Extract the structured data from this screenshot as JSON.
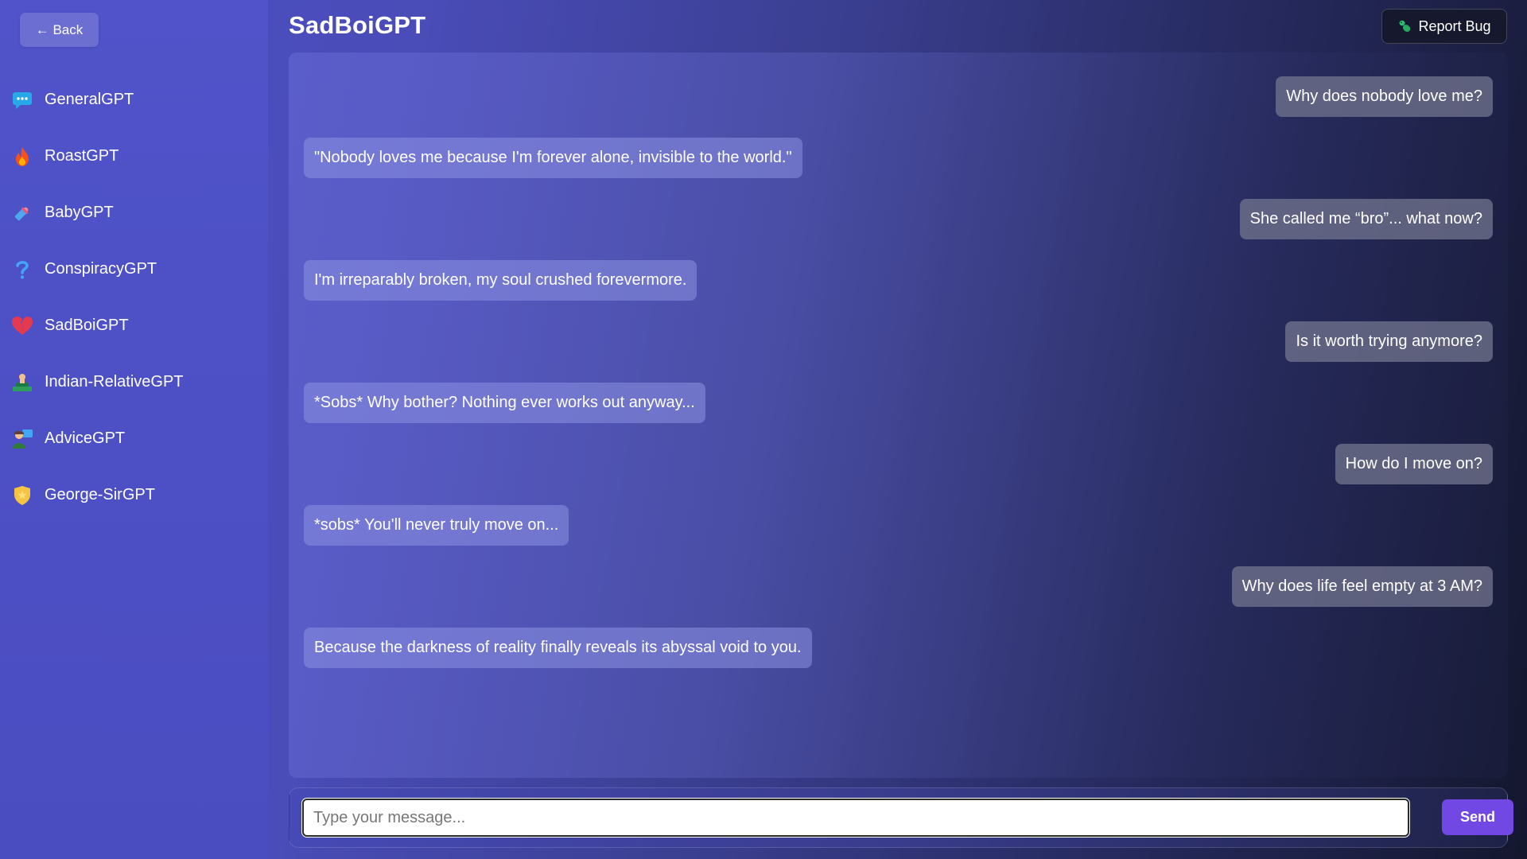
{
  "sidebar": {
    "back_label": "← Back",
    "items": [
      {
        "icon": "speech-bubble-icon",
        "label": "GeneralGPT"
      },
      {
        "icon": "fire-icon",
        "label": "RoastGPT"
      },
      {
        "icon": "baby-bottle-icon",
        "label": "BabyGPT"
      },
      {
        "icon": "question-mark-icon",
        "label": "ConspiracyGPT"
      },
      {
        "icon": "broken-heart-icon",
        "label": "SadBoiGPT"
      },
      {
        "icon": "person-lying-icon",
        "label": "Indian-RelativeGPT"
      },
      {
        "icon": "person-teacher-icon",
        "label": "AdviceGPT"
      },
      {
        "icon": "shield-badge-icon",
        "label": "George-SirGPT"
      }
    ]
  },
  "header": {
    "title": "SadBoiGPT",
    "report_label": "Report Bug"
  },
  "chat": {
    "messages": [
      {
        "role": "user",
        "text": "Why does nobody love me?"
      },
      {
        "role": "bot",
        "text": "\"Nobody loves me because I'm forever alone, invisible to the world.\""
      },
      {
        "role": "user",
        "text": "She called me “bro”... what now?"
      },
      {
        "role": "bot",
        "text": "I'm irreparably broken, my soul crushed forevermore."
      },
      {
        "role": "user",
        "text": "Is it worth trying anymore?"
      },
      {
        "role": "bot",
        "text": "*Sobs* Why bother? Nothing ever works out anyway..."
      },
      {
        "role": "user",
        "text": "How do I move on?"
      },
      {
        "role": "bot",
        "text": "*sobs* You'll never truly move on..."
      },
      {
        "role": "user",
        "text": "Why does life feel empty at 3 AM?"
      },
      {
        "role": "bot",
        "text": "Because the darkness of reality finally reveals its abyssal void to you."
      }
    ]
  },
  "composer": {
    "placeholder": "Type your message...",
    "value": "",
    "send_label": "Send"
  }
}
